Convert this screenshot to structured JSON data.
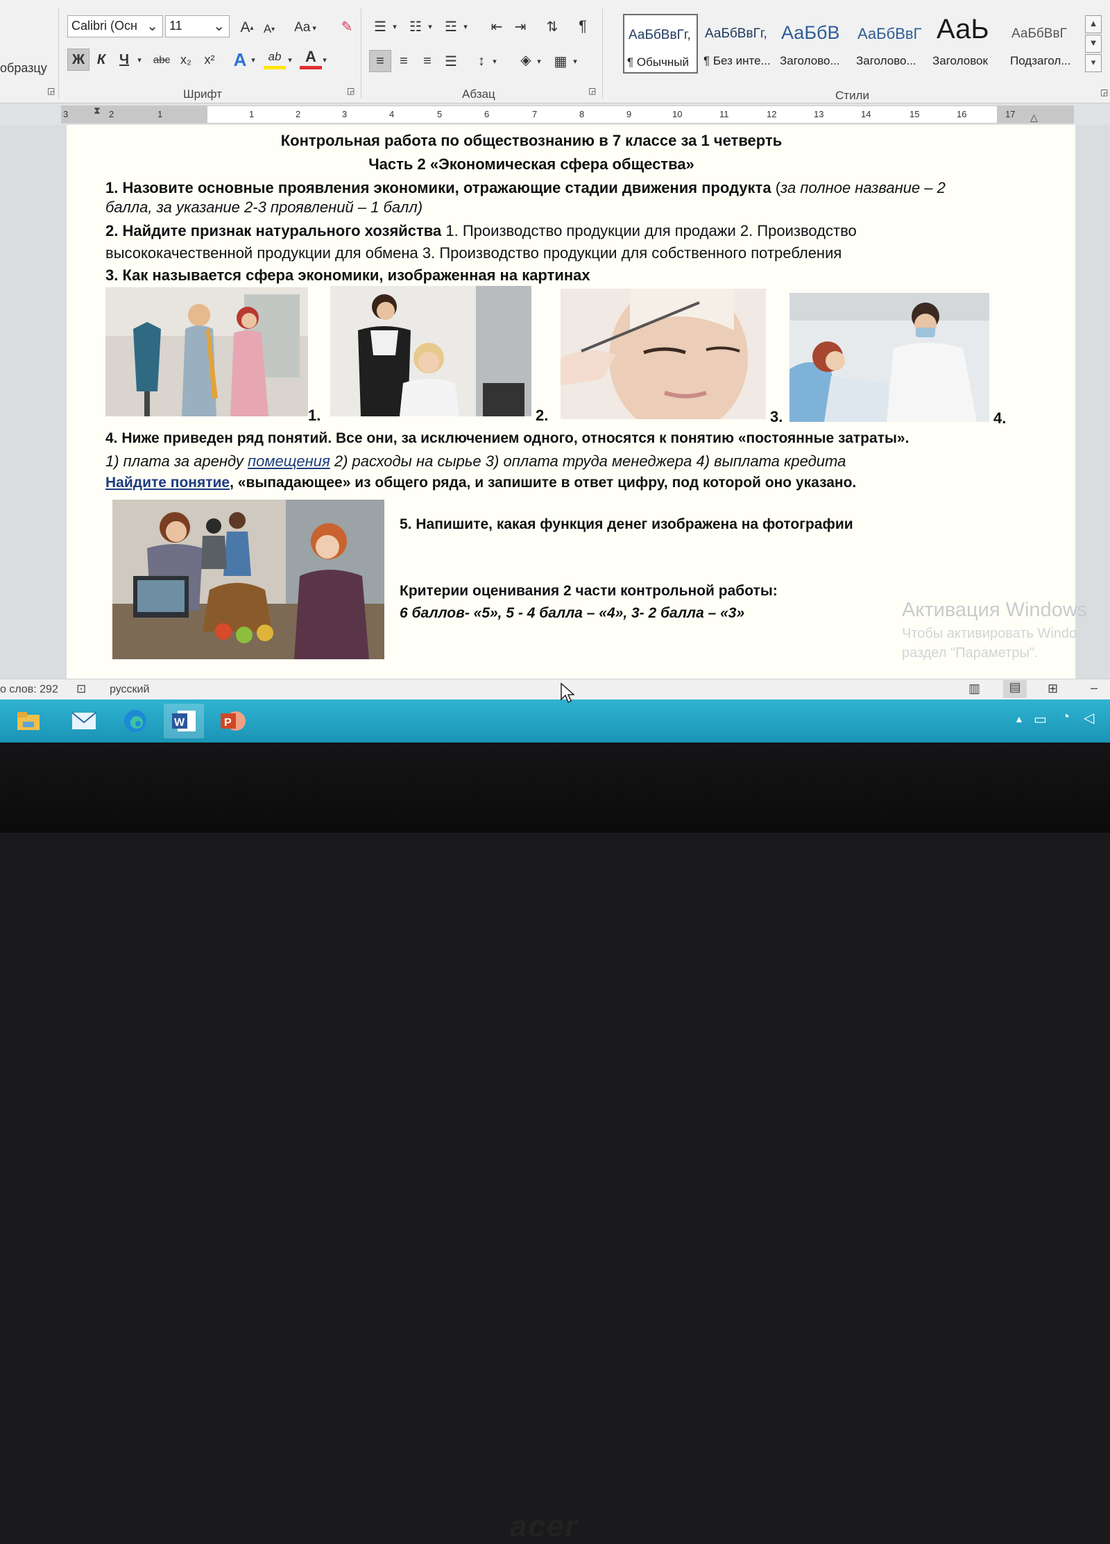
{
  "ribbon": {
    "clipboard": {
      "format_painter": "образцу"
    },
    "font": {
      "name": "Calibri (Осн",
      "size": "11",
      "grow": "A",
      "shrink": "A",
      "case": "Aa",
      "bold": "Ж",
      "italic": "К",
      "underline": "Ч",
      "strike": "abc",
      "sub": "x₂",
      "sup": "x²",
      "effects": "A",
      "highlight": "ab",
      "color": "A",
      "group_label": "Шрифт",
      "underline_color": "#e03030",
      "highlight_color": "#ffe600"
    },
    "paragraph": {
      "group_label": "Абзац",
      "pilcrow": "¶"
    },
    "styles": {
      "group_label": "Стили",
      "items": [
        {
          "sample": "АаБбВвГг,",
          "name": "¶ Обычный"
        },
        {
          "sample": "АаБбВвГг,",
          "name": "¶ Без инте..."
        },
        {
          "sample": "АаБбВ",
          "name": "Заголово..."
        },
        {
          "sample": "АаБбВвГ",
          "name": "Заголово..."
        },
        {
          "sample": "АаЬ",
          "name": "Заголовок"
        },
        {
          "sample": "АаБбВвГ",
          "name": "Подзагол..."
        }
      ]
    }
  },
  "ruler": {
    "numbers": [
      "3",
      "2",
      "1",
      "1",
      "2",
      "3",
      "4",
      "5",
      "6",
      "7",
      "8",
      "9",
      "10",
      "11",
      "12",
      "13",
      "14",
      "15",
      "16",
      "17"
    ]
  },
  "document": {
    "title": "Контрольная работа по обществознанию в 7 классе за 1 четверть",
    "subtitle": "Часть 2 «Экономическая сфера общества»",
    "q1_bold": "1. Назовите основные проявления экономики, отражающие стадии движения продукта",
    "q1_paren": "(",
    "q1_italic_a": "за полное название – 2",
    "q1_italic_b": "балла, за указание 2-3 проявлений – 1 балл)",
    "q2_bold": "2. Найдите признак натурального хозяйства",
    "q2_text_a": "1. Производство продукции для продажи 2. Производство",
    "q2_text_b": "высококачественной продукции для обмена 3. Производство продукции для собственного потребления",
    "q3_bold": "3. Как называется сфера экономики, изображенная на картинах",
    "photo_labels": [
      "1.",
      "2.",
      "3.",
      "4."
    ],
    "q4_bold": "4. Ниже приведен ряд понятий. Все они, за исключением одного, относятся к понятию «постоянные затраты».",
    "q4_list_a": "1) плата за аренду",
    "q4_list_link": "помещения",
    "q4_list_b": "2) расходы на сырье  3) оплата труда менеджера  4) выплата кредита",
    "q4_find_link": "Найдите  понятие",
    "q4_find_rest": ", «выпадающее» из общего ряда, и запишите в ответ цифру, под которой оно указано.",
    "q5_bold": "5. Напишите, какая функция денег изображена на фотографии",
    "criteria_title": "Критерии оценивания 2 части контрольной работы:",
    "criteria_text": "6 баллов- «5»,  5 - 4 балла – «4»,  3- 2 балла – «3»"
  },
  "watermark": {
    "line1": "Активация Windows",
    "line2": "Чтобы активировать Windo",
    "line3": "раздел \"Параметры\"."
  },
  "status": {
    "word_count": "о слов: 292",
    "language": "русский"
  },
  "taskbar": {
    "apps": [
      "file-explorer",
      "mail",
      "edge",
      "word",
      "powerpoint"
    ]
  },
  "brand": "acer"
}
